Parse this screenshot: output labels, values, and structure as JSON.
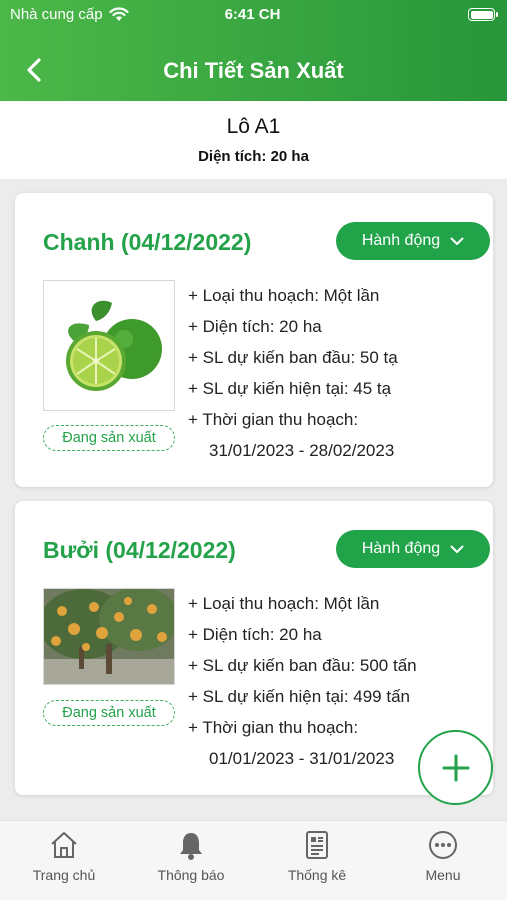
{
  "status_bar": {
    "carrier": "Nhà cung cấp",
    "time": "6:41 CH"
  },
  "header": {
    "title": "Chi Tiết Sản Xuất"
  },
  "lot": {
    "name": "Lô A1",
    "area": "Diện tích: 20 ha"
  },
  "products": [
    {
      "title": "Chanh (04/12/2022)",
      "action_label": "Hành động",
      "status": "Đang sản xuất",
      "image": "lime-image",
      "details": [
        "+ Loại thu hoạch: Một lần",
        "+ Diện tích: 20 ha",
        "+ SL dự kiến ban đầu: 50 tạ",
        "+ SL dự kiến hiện tại: 45 tạ",
        "+ Thời gian thu hoạch:"
      ],
      "harvest_range": "31/01/2023 - 28/02/2023"
    },
    {
      "title": "Bưởi (04/12/2022)",
      "action_label": "Hành động",
      "status": "Đang sản xuất",
      "image": "pomelo-tree-image",
      "details": [
        "+ Loại thu hoạch: Một lần",
        "+ Diện tích: 20 ha",
        "+ SL dự kiến ban đầu: 500 tấn",
        "+ SL dự kiến hiện tại: 499 tấn",
        "+ Thời gian thu hoạch:"
      ],
      "harvest_range": "01/01/2023 - 31/01/2023"
    }
  ],
  "bottom_nav": [
    {
      "label": "Trang chủ",
      "icon": "home-icon"
    },
    {
      "label": "Thông báo",
      "icon": "bell-icon"
    },
    {
      "label": "Thống kê",
      "icon": "report-icon"
    },
    {
      "label": "Menu",
      "icon": "more-icon"
    }
  ],
  "colors": {
    "primary": "#21a34a",
    "header_start": "#4cb848",
    "header_end": "#27963a"
  }
}
